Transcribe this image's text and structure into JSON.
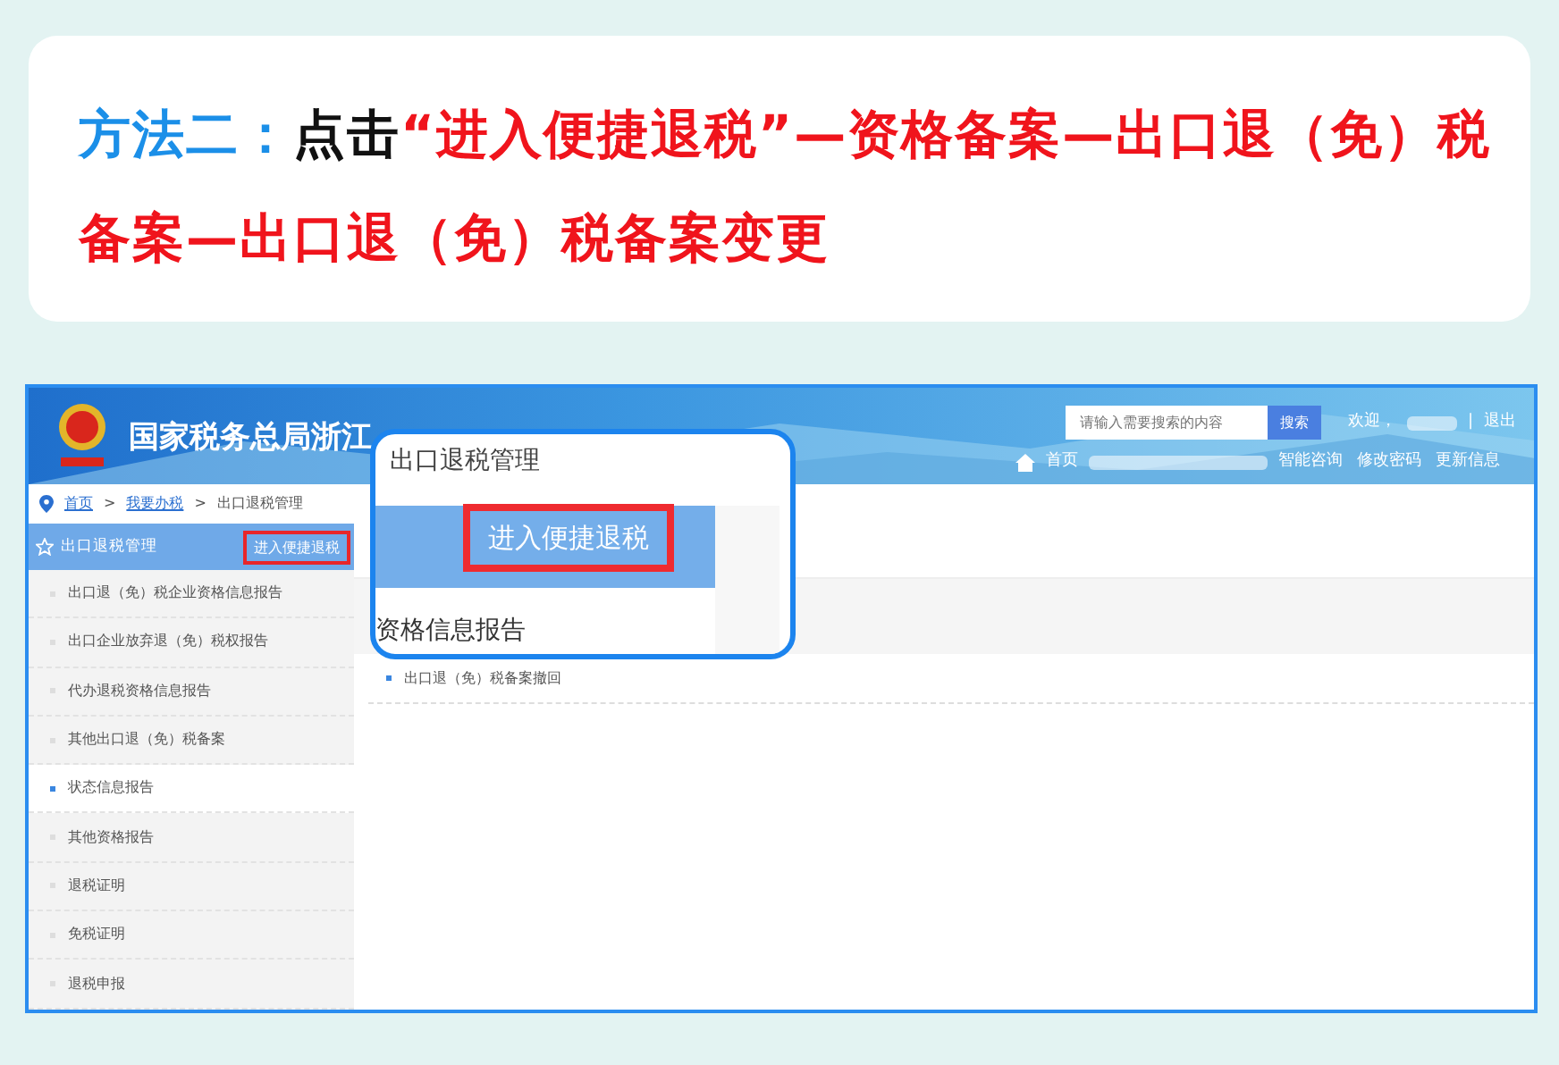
{
  "heading": [
    {
      "kind": "label",
      "text": "方法二："
    },
    {
      "kind": "plain",
      "text": "点击"
    },
    {
      "kind": "highlight",
      "text": "“进入便捷退税”—资格备案—出口退（免）税备案—出口退（免）税备案变更"
    }
  ],
  "header": {
    "site_title": "国家税务总局浙江",
    "search": {
      "placeholder": "请输入需要搜索的内容",
      "button": "搜索"
    },
    "welcome": "欢迎，",
    "separator": "|",
    "logout": "退出",
    "home": "首页",
    "links": [
      "智能咨询",
      "修改密码",
      "更新信息"
    ]
  },
  "breadcrumb": [
    "首页",
    "我要办税",
    "出口退税管理"
  ],
  "breadcrumb_separator": ">",
  "sidebar": {
    "title": "出口退税管理",
    "quick_button": "进入便捷退税",
    "items": [
      {
        "label": "出口退（免）税企业资格信息报告",
        "selected": false
      },
      {
        "label": "出口企业放弃退（免）税权报告",
        "selected": false
      },
      {
        "label": "代办退税资格信息报告",
        "selected": false
      },
      {
        "label": "其他出口退（免）税备案",
        "selected": false
      },
      {
        "label": "状态信息报告",
        "selected": true
      },
      {
        "label": "其他资格报告",
        "selected": false
      },
      {
        "label": "退税证明",
        "selected": false
      },
      {
        "label": "免税证明",
        "selected": false
      },
      {
        "label": "退税申报",
        "selected": false
      }
    ]
  },
  "content_items": [
    "出口退（免）税备案撤回"
  ],
  "callout": {
    "title": "出口退税管理",
    "button": "进入便捷退税",
    "caption": "资格信息报告"
  }
}
